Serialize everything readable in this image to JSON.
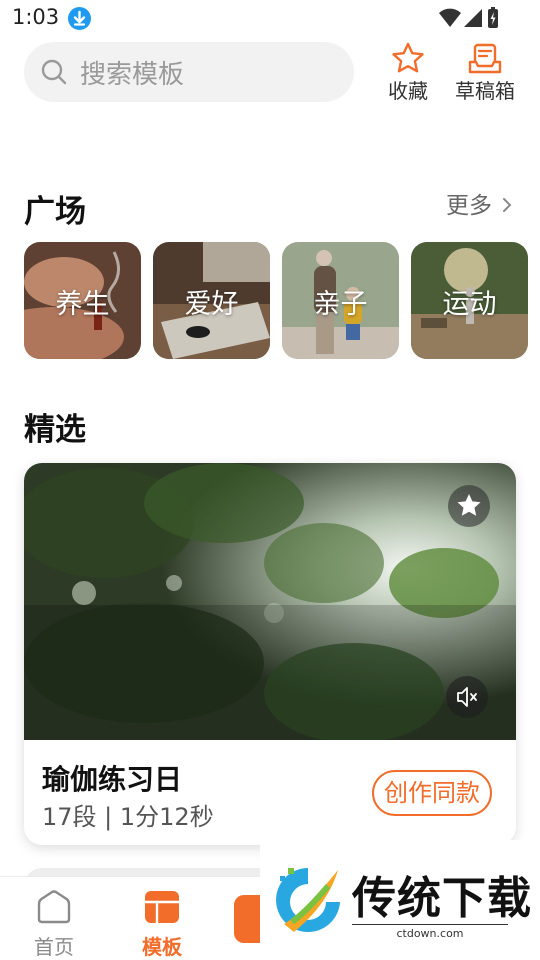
{
  "status_bar": {
    "time": "1:03"
  },
  "header": {
    "search_placeholder": "搜索模板",
    "favorites_label": "收藏",
    "drafts_label": "草稿箱"
  },
  "square": {
    "title": "广场",
    "more_label": "更多",
    "items": [
      {
        "label": "养生"
      },
      {
        "label": "爱好"
      },
      {
        "label": "亲子"
      },
      {
        "label": "运动"
      }
    ]
  },
  "featured": {
    "title": "精选",
    "card": {
      "title": "瑜伽练习日",
      "meta": "17段 | 1分12秒",
      "create_label": "创作同款"
    }
  },
  "bottom_nav": {
    "items": [
      {
        "label": "首页"
      },
      {
        "label": "模板"
      }
    ]
  },
  "watermark": {
    "text": "传统下载",
    "url": "ctdown.com"
  },
  "colors": {
    "accent": "#f26c2a",
    "nav_inactive": "#8a8a8a",
    "download_badge": "#1e9bf0"
  },
  "icons": [
    "download-icon",
    "wifi-icon",
    "signal-icon",
    "battery-icon",
    "search-icon",
    "star-icon",
    "draft-box-icon",
    "chevron-right-icon",
    "mute-icon",
    "home-icon",
    "template-icon"
  ]
}
